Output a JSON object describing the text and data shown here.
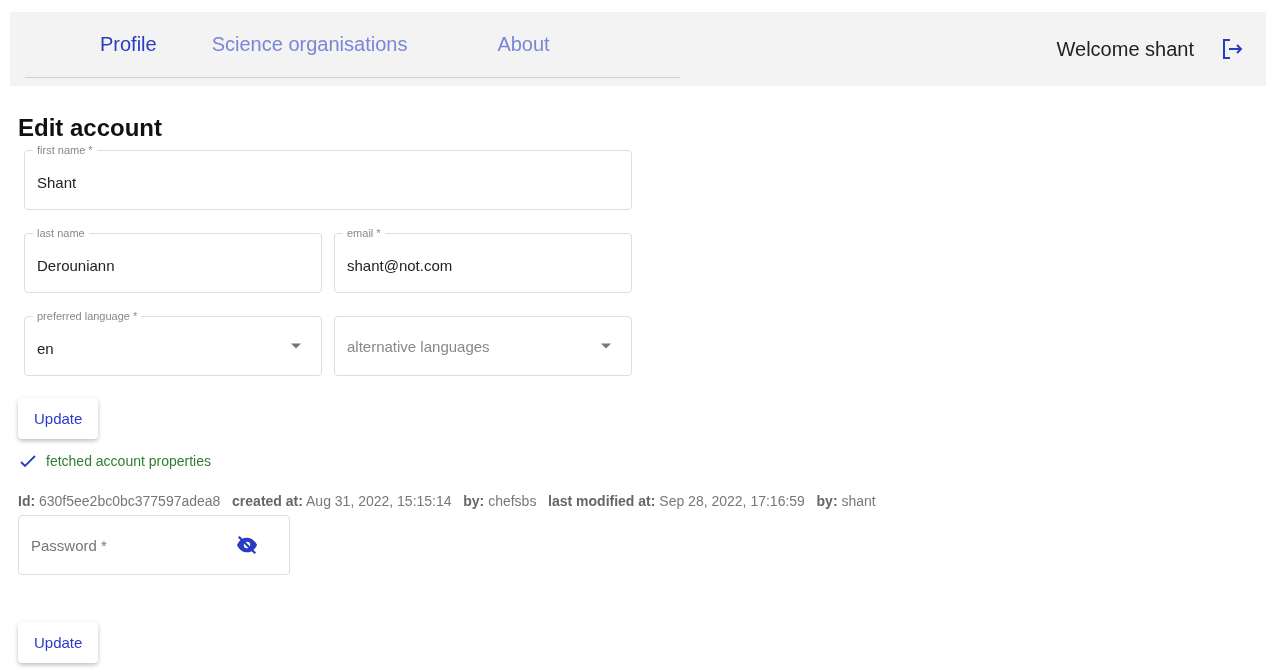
{
  "nav": {
    "tabs": [
      {
        "label": "Profile",
        "selected": true
      },
      {
        "label": "Science organisations",
        "selected": false
      },
      {
        "label": "About",
        "selected": false
      }
    ],
    "welcome": "Welcome shant"
  },
  "heading": "Edit account",
  "form_rows": [
    [
      {
        "kind": "text",
        "label": "first name *",
        "value": "Shant"
      }
    ],
    [
      {
        "kind": "text",
        "label": "last name",
        "value": "Derouniann"
      },
      {
        "kind": "text",
        "label": "email *",
        "value": "shant@not.com"
      }
    ],
    [
      {
        "kind": "select",
        "label": "preferred language *",
        "value": "en"
      },
      {
        "kind": "select",
        "placeholder": "alternative languages"
      }
    ]
  ],
  "update_button": "Update",
  "status": {
    "ok": true,
    "text": "fetched account properties"
  },
  "meta": "**Id:** 630f5ee2bc0bc377597adea8   **created at:** Aug 31, 2022, 15:15:14   **by:** chefsbs   **last modified at:** Sep 28, 2022, 17:16:59   **by:** shant",
  "password": {
    "placeholder": "Password *",
    "visible": false
  },
  "password_button": "Update"
}
